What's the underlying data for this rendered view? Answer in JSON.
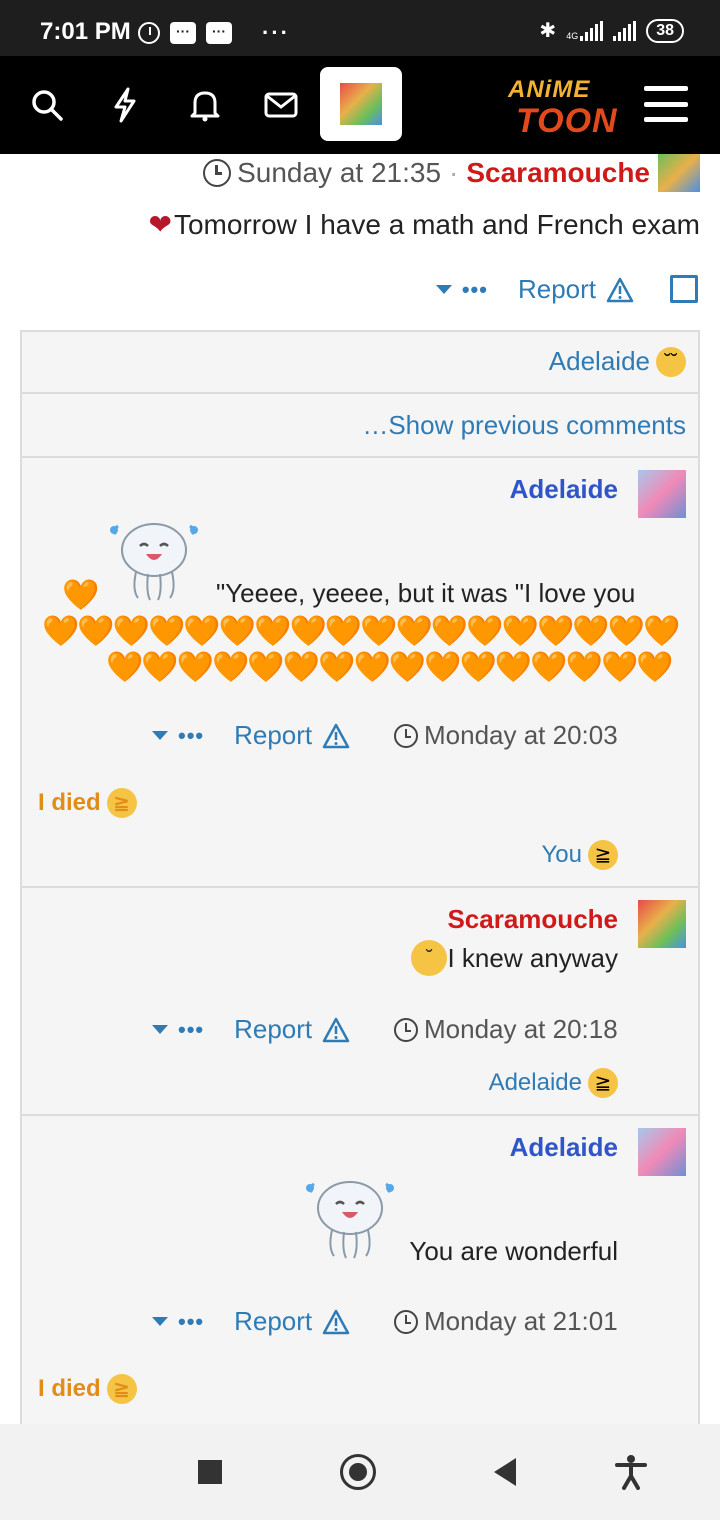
{
  "status_bar": {
    "time": "7:01 PM",
    "network": "4G",
    "battery": "38",
    "more": "···"
  },
  "topnav": {
    "logo_top": "ANiME",
    "logo_bottom": "TOON"
  },
  "post": {
    "timestamp": "Sunday at 21:35",
    "separator": "·",
    "author": "Scaramouche",
    "status_text": "Tomorrow I have a math and French exam",
    "report_label": "Report"
  },
  "thread": {
    "reactor_label": "Adelaide",
    "show_previous": "…Show previous comments",
    "comments": [
      {
        "author": "Adelaide",
        "text": "\"Yeeee, yeeee, but it was \"I love you",
        "report_label": "Report",
        "timestamp": "Monday at 20:03",
        "reaction_label": "I died",
        "reactor": "You"
      },
      {
        "author": "Scaramouche",
        "text": "I knew anyway",
        "report_label": "Report",
        "timestamp": "Monday at 20:18",
        "reactor": "Adelaide"
      },
      {
        "author": "Adelaide",
        "text": "You are wonderful",
        "report_label": "Report",
        "timestamp": "Monday at 21:01",
        "reaction_label": "I died"
      }
    ]
  },
  "colors": {
    "link_blue": "#2f7bb5",
    "user_red": "#d01a1a",
    "user_blue": "#2f55c8",
    "reaction_orange": "#e08d1a",
    "heart": "#e8591f"
  },
  "icons": [
    "search-icon",
    "flash-icon",
    "bell-icon",
    "mail-icon",
    "hamburger-icon",
    "clock-icon",
    "warning-icon",
    "caret-down-icon",
    "square-icon",
    "circle-icon",
    "back-icon",
    "accessibility-icon"
  ]
}
